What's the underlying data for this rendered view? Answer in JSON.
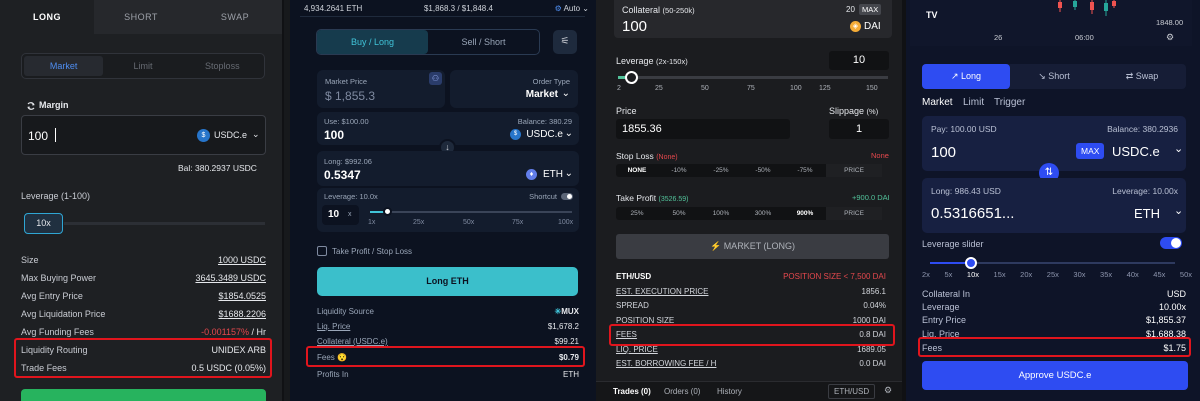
{
  "p1": {
    "tabs": [
      "LONG",
      "SHORT",
      "SWAP"
    ],
    "order_types": [
      "Market",
      "Limit",
      "Stoploss"
    ],
    "margin_label": "Margin",
    "margin_value": "100",
    "token": "USDC.e",
    "balance": "Bal: 380.2937 USDC",
    "leverage_label": "Leverage (1-100)",
    "leverage_value": "10x",
    "rows": [
      {
        "label": "Size",
        "value": "1000 USDC"
      },
      {
        "label": "Max Buying Power",
        "value": "3645.3489 USDC"
      },
      {
        "label": "Avg Entry Price",
        "value": "$1854.0525"
      },
      {
        "label": "Avg Liquidation Price",
        "value": "$1688.2206"
      },
      {
        "label": "Avg Funding Fees",
        "value": "-0.001157%",
        "suffix": " / Hr"
      },
      {
        "label": "Liquidity Routing",
        "value": "UNIDEX ARB"
      },
      {
        "label": "Trade Fees",
        "value": "0.5 USDC (0.05%)"
      }
    ]
  },
  "p2": {
    "eth_amount": "4,934.2641 ETH",
    "price_range": "$1,868.3 / $1,848.4",
    "auto": "Auto",
    "buy_long": "Buy / Long",
    "sell_short": "Sell / Short",
    "market_price_label": "Market Price",
    "market_price": "$ 1,855.3",
    "order_type_label": "Order Type",
    "order_type": "Market",
    "use_label": "Use: $100.00",
    "balance_label": "Balance: 380.29",
    "use_value": "100",
    "use_token": "USDC.e",
    "long_label": "Long: $992.06",
    "long_value": "0.5347",
    "long_token": "ETH",
    "lev_label": "Leverage: 10.0x",
    "shortcut": "Shortcut",
    "lev_value": "10",
    "lev_x": "x",
    "lev_ticks": [
      "1x",
      "25x",
      "50x",
      "75x",
      "100x"
    ],
    "tp_sl": "Take Profit / Stop Loss",
    "action": "Long ETH",
    "rows": [
      {
        "label": "Liquidity Source",
        "value": "MUX"
      },
      {
        "label": "Liq. Price",
        "value": "$1,678.2"
      },
      {
        "label": "Collateral (USDC.e)",
        "value": "$99.21"
      },
      {
        "label": "Fees",
        "value": "$0.79"
      },
      {
        "label": "Profits In",
        "value": "ETH"
      }
    ]
  },
  "p3": {
    "collateral_label": "Collateral",
    "collateral_range": "(50-250k)",
    "collateral_value": "100",
    "max_num": "20",
    "max": "MAX",
    "dai": "DAI",
    "leverage_label": "Leverage",
    "leverage_range": "(2x-150x)",
    "leverage_value": "10",
    "lev_ticks": [
      "2",
      "25",
      "50",
      "75",
      "100",
      "125",
      "150"
    ],
    "price_label": "Price",
    "price_value": "1855.36",
    "slippage_label": "Slippage",
    "slippage_unit": "(%)",
    "slippage_value": "1",
    "sl_label": "Stop Loss",
    "sl_tag": "(None)",
    "sl_right": "None",
    "sl_opts": [
      "NONE",
      "-10%",
      "-25%",
      "-50%",
      "-75%",
      "PRICE"
    ],
    "tp_label": "Take Profit",
    "tp_tag": "(3526.59)",
    "tp_right": "+900.0 DAI",
    "tp_opts": [
      "25%",
      "50%",
      "100%",
      "300%",
      "900%",
      "PRICE"
    ],
    "market_btn": "MARKET (LONG)",
    "pair": "ETH/USD",
    "pos_warning": "POSITION SIZE < 7,500 DAI",
    "rows": [
      {
        "label": "EST. EXECUTION PRICE",
        "value": "1856.1"
      },
      {
        "label": "SPREAD",
        "value": "0.04%"
      },
      {
        "label": "POSITION SIZE",
        "value": "1000 DAI"
      },
      {
        "label": "FEES",
        "value": "0.8 DAI"
      },
      {
        "label": "LIQ. PRICE",
        "value": "1689.05"
      },
      {
        "label": "EST. BORROWING FEE / H",
        "value": "0.0 DAI"
      }
    ],
    "bottom_tabs": [
      "Trades (0)",
      "Orders (0)",
      "History"
    ],
    "bottom_pair": "ETH/USD"
  },
  "p4": {
    "chart_price": "1848.00",
    "chart_x": [
      "26",
      "06:00"
    ],
    "tabs": [
      "Long",
      "Short",
      "Swap"
    ],
    "order_types": [
      "Market",
      "Limit",
      "Trigger"
    ],
    "pay_label": "Pay: 100.00 USD",
    "balance_label": "Balance: 380.2936",
    "pay_value": "100",
    "max": "MAX",
    "pay_token": "USDC.e",
    "long_label": "Long: 986.43 USD",
    "lev_label": "Leverage: 10.00x",
    "long_value": "0.5316651...",
    "long_token": "ETH",
    "slider_label": "Leverage slider",
    "lev_ticks": [
      "2x",
      "5x",
      "10x",
      "15x",
      "20x",
      "25x",
      "30x",
      "35x",
      "40x",
      "45x",
      "50x"
    ],
    "rows": [
      {
        "label": "Collateral In",
        "value": "USD"
      },
      {
        "label": "Leverage",
        "value": "10.00x"
      },
      {
        "label": "Entry Price",
        "value": "$1,855.37"
      },
      {
        "label": "Liq. Price",
        "value": "$1,688.38"
      },
      {
        "label": "Fees",
        "value": "$1.75"
      }
    ],
    "approve": "Approve USDC.e"
  },
  "colors": {
    "highlight": "#e0151d",
    "teal": "#3fc3cf",
    "blue": "#2e4cf2",
    "green": "#27b35e"
  }
}
